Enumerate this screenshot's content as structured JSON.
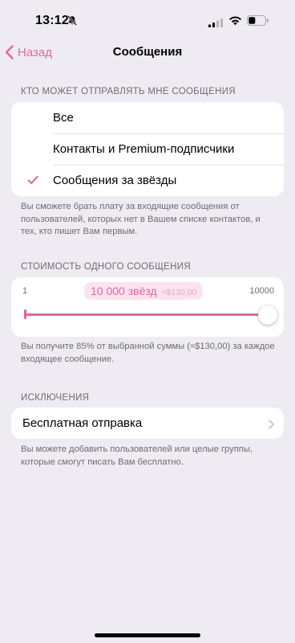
{
  "status_bar": {
    "time": "13:12"
  },
  "nav": {
    "back_label": "Назад",
    "title": "Сообщения"
  },
  "who_can_message": {
    "header": "КТО МОЖЕТ ОТПРАВЛЯТЬ МНЕ СООБЩЕНИЯ",
    "options": [
      {
        "label": "Все",
        "selected": false
      },
      {
        "label": "Контакты и Premium-подписчики",
        "selected": false
      },
      {
        "label": "Сообщения за звёзды",
        "selected": true
      }
    ],
    "footer": "Вы сможете брать плату за входящие сообщения от пользователей, которых нет в Вашем списке контактов, и тех, кто пишет Вам первым."
  },
  "price": {
    "header": "СТОИМОСТЬ ОДНОГО СООБЩЕНИЯ",
    "min_label": "1",
    "max_label": "10000",
    "value_label": "10 000 звёзд",
    "value_usd": "≈$130,00",
    "slider_value": 10000,
    "footer": "Вы получите 85% от выбранной суммы (≈$130,00) за каждое входящее сообщение."
  },
  "exceptions": {
    "header": "ИСКЛЮЧЕНИЯ",
    "row_label": "Бесплатная отправка",
    "footer": "Вы можете добавить пользователей или целые группы, которые смогут писать Вам бесплатно."
  },
  "colors": {
    "accent": "#e0679f",
    "background": "#eeebf2",
    "card": "#ffffff",
    "secondary_text": "#6d6d72"
  }
}
